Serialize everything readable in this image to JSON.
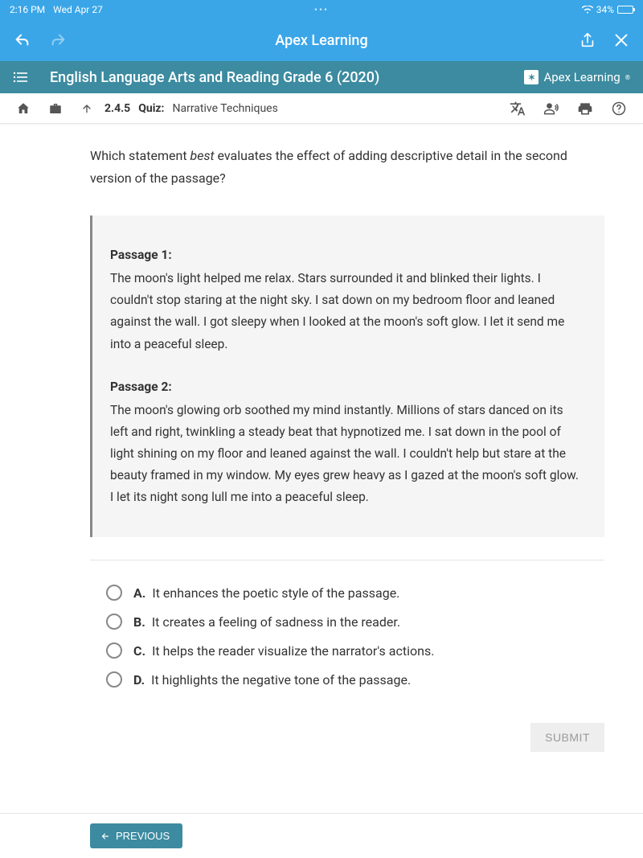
{
  "status": {
    "time": "2:16 PM",
    "date": "Wed Apr 27",
    "battery_pct": "34%"
  },
  "nav": {
    "title": "Apex Learning"
  },
  "course": {
    "title": "English Language Arts and Reading Grade 6 (2020)",
    "brand": "Apex Learning"
  },
  "breadcrumb": {
    "number": "2.4.5",
    "type": "Quiz:",
    "label": "Narrative Techniques"
  },
  "question": {
    "pre": "Which statement ",
    "em": "best",
    "post": " evaluates the effect of adding descriptive detail in the second version of the passage?"
  },
  "passages": {
    "p1_title": "Passage 1:",
    "p1_body": "The moon's light helped me relax. Stars surrounded it and blinked their lights. I couldn't stop staring at the night sky. I sat down on my bedroom floor and leaned against the wall. I got sleepy when I looked at the moon's soft glow. I let it send me into a peaceful sleep.",
    "p2_title": "Passage 2:",
    "p2_body": "The moon's glowing orb soothed my mind instantly. Millions of stars danced on its left and right, twinkling a steady beat that hypnotized me. I sat down in the pool of light shining on my floor and leaned against the wall. I couldn't help but stare at the beauty framed in my window. My eyes grew heavy as I gazed at the moon's soft glow. I let its night song lull me into a peaceful sleep."
  },
  "answers": [
    {
      "letter": "A.",
      "text": "It enhances the poetic style of the passage."
    },
    {
      "letter": "B.",
      "text": "It creates a feeling of sadness in the reader."
    },
    {
      "letter": "C.",
      "text": "It helps the reader visualize the narrator's actions."
    },
    {
      "letter": "D.",
      "text": "It highlights the negative tone of the passage."
    }
  ],
  "buttons": {
    "submit": "SUBMIT",
    "previous": "PREVIOUS"
  }
}
